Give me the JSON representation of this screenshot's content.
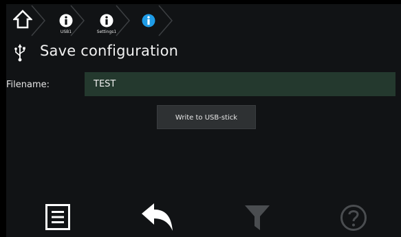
{
  "breadcrumb": {
    "items": [
      {
        "label": "USB1",
        "icon": "info-icon"
      },
      {
        "label": "Settings1",
        "icon": "info-icon"
      },
      {
        "label": "",
        "icon": "info-icon"
      }
    ]
  },
  "header": {
    "title": "Save configuration",
    "icon": "usb-icon"
  },
  "form": {
    "filename_label": "Filename:",
    "filename_value": "TEST",
    "write_button": "Write to USB-stick"
  },
  "toolbar": {
    "items": [
      "menu-icon",
      "back-icon",
      "filter-icon",
      "help-icon"
    ]
  },
  "colors": {
    "background": "#111315",
    "field": "#24392e",
    "button": "#2e3133",
    "active_info": "#1e9be6",
    "disabled": "#4a4d50"
  }
}
